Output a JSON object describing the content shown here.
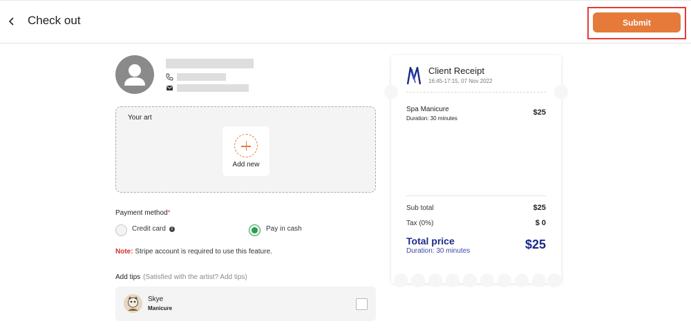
{
  "header": {
    "title": "Check out",
    "submit_label": "Submit"
  },
  "client": {
    "phone_icon": "phone-icon",
    "email_icon": "mail-icon"
  },
  "art": {
    "label": "Your art",
    "add_label": "Add new"
  },
  "payment": {
    "title": "Payment method",
    "required_mark": "*",
    "options": [
      {
        "label": "Credit card",
        "selected": false
      },
      {
        "label": "Pay in cash",
        "selected": true
      }
    ],
    "note_prefix": "Note:",
    "note_text": " Stripe account is required to use this feature."
  },
  "tips": {
    "title": "Add tips",
    "hint": "(Satisfied with the artist? Add tips)",
    "artist": {
      "name": "Skye",
      "service": "Manicure",
      "checked": false
    }
  },
  "receipt": {
    "title": "Client Receipt",
    "datetime": "16:45-17:15, 07 Nov 2022",
    "item": {
      "name": "Spa Manicure",
      "duration": "Duration: 30 minutes",
      "price": "$25"
    },
    "subtotal_label": "Sub total",
    "subtotal_value": "$25",
    "tax_label": "Tax (0%)",
    "tax_value": "$ 0",
    "total_label": "Total price",
    "total_duration": "Duration: 30 minutes",
    "total_value": "$25"
  },
  "colors": {
    "accent": "#e57a3b",
    "highlight": "#e53935",
    "total_blue": "#1a2a8a",
    "radio_green": "#2e9b52"
  }
}
